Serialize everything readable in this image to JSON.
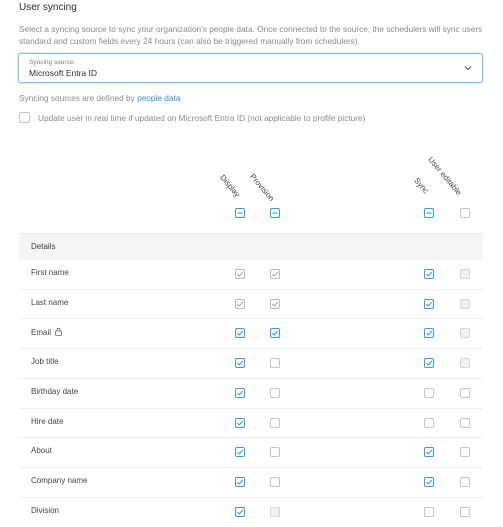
{
  "header": {
    "title": "User syncing",
    "description": "Select a syncing source to sync your organization's people data. Once connected to the source, the schedulers will sync users standard and custom fields every 24 hours (can also be triggered manually from schedulers)."
  },
  "source_select": {
    "label": "Syncing source:",
    "value": "Microsoft Entra ID"
  },
  "note": {
    "prefix": "Syncing sources are defined by",
    "link": "people data"
  },
  "realtime_option": {
    "label": "Update user in real time if updated on Microsoft Entra ID (not applicable to profile picture)",
    "checked": false
  },
  "columns": [
    "Display",
    "Provision",
    "Sync",
    "User editable"
  ],
  "section": "Details",
  "rows": [
    {
      "name": "First name",
      "display": "gray",
      "provision": "gray",
      "sync": "blue",
      "editable": "disabled",
      "locked": false
    },
    {
      "name": "Last name",
      "display": "gray",
      "provision": "gray",
      "sync": "blue",
      "editable": "disabled",
      "locked": false
    },
    {
      "name": "Email",
      "display": "blue",
      "provision": "blue",
      "sync": "blue",
      "editable": "disabled",
      "locked": true
    },
    {
      "name": "Job title",
      "display": "blue",
      "provision": "empty",
      "sync": "blue",
      "editable": "disabled",
      "locked": false
    },
    {
      "name": "Birthday date",
      "display": "blue",
      "provision": "empty",
      "sync": "empty",
      "editable": "empty",
      "locked": false
    },
    {
      "name": "Hire date",
      "display": "blue",
      "provision": "empty",
      "sync": "empty",
      "editable": "empty",
      "locked": false
    },
    {
      "name": "About",
      "display": "blue",
      "provision": "empty",
      "sync": "blue",
      "editable": "empty",
      "locked": false
    },
    {
      "name": "Company name",
      "display": "blue",
      "provision": "empty",
      "sync": "blue",
      "editable": "empty",
      "locked": false
    },
    {
      "name": "Division",
      "display": "blue",
      "provision": "disabled",
      "sync": "empty",
      "editable": "empty",
      "locked": false
    }
  ],
  "colors": {
    "accent": "#3d9ad8",
    "link": "#2a8fd6",
    "checked_gray": "#a8a8a8"
  }
}
